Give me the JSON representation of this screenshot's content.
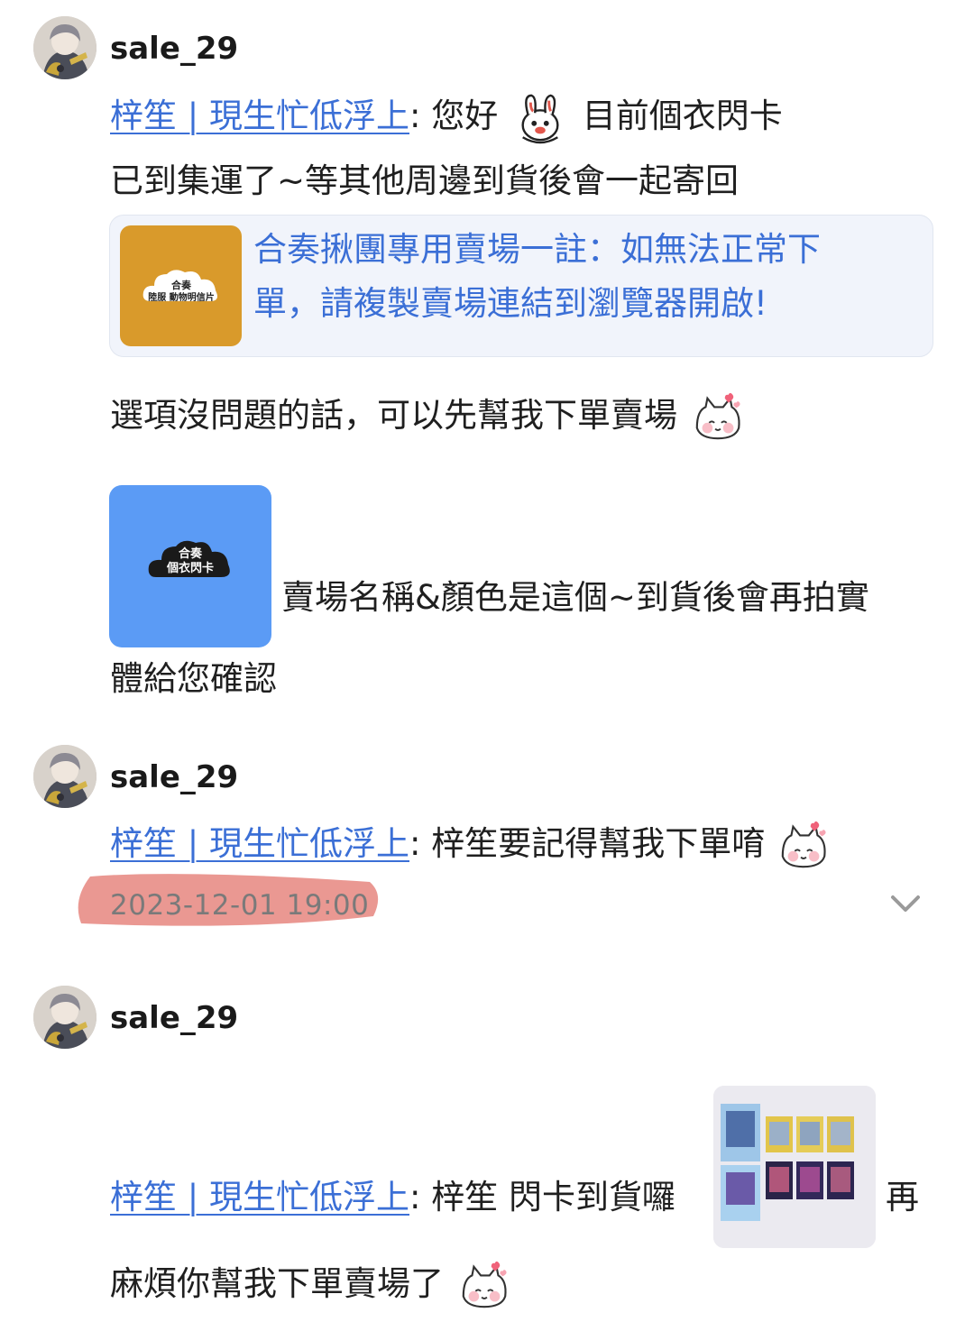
{
  "messages": [
    {
      "username": "sale_29",
      "sender": "梓笙 | 現生忙低浮上",
      "line1_after_sender": ": 您好",
      "line1_after_emoji": "目前個衣閃卡",
      "line2": "已到集運了~等其他周邊到貨後會一起寄回",
      "link_card": {
        "title_line1": "合奏揪團專用賣場一註：如無法正常下",
        "title_line2": "單，請複製賣場連結到瀏覽器開啟!",
        "thumb_line1": "合奏",
        "thumb_line2": "陸服 動物明信片"
      },
      "line3": "選項沒問題的話，可以先幫我下單賣場",
      "image_card": {
        "line1": "合奏",
        "line2": "個衣閃卡"
      },
      "line4_after_image": "賣場名稱&顏色是這個~到貨後會再拍實",
      "line5": "體給您確認"
    },
    {
      "username": "sale_29",
      "sender": "梓笙 | 現生忙低浮上",
      "text": ": 梓笙要記得幫我下單唷",
      "timestamp": "2023-12-01 19:00"
    },
    {
      "username": "sale_29",
      "sender": "梓笙 | 現生忙低浮上",
      "text_before_photo": ": 梓笙 閃卡到貨囉",
      "text_after_photo": "再",
      "line2": "麻煩你幫我下單賣場了"
    }
  ],
  "icons": {
    "avatar": "avatar-icon",
    "rabbit_emoji": "rabbit-emoji-icon",
    "cat_emoji": "cat-heart-emoji-icon",
    "expand": "chevron-down-icon"
  },
  "colors": {
    "link": "#3b6fd6",
    "link_card_bg": "#f1f4fb",
    "link_thumb": "#d99a2b",
    "image_card": "#5b9bf5",
    "highlight": "#e88d86",
    "timestamp": "#7a7a7a"
  }
}
